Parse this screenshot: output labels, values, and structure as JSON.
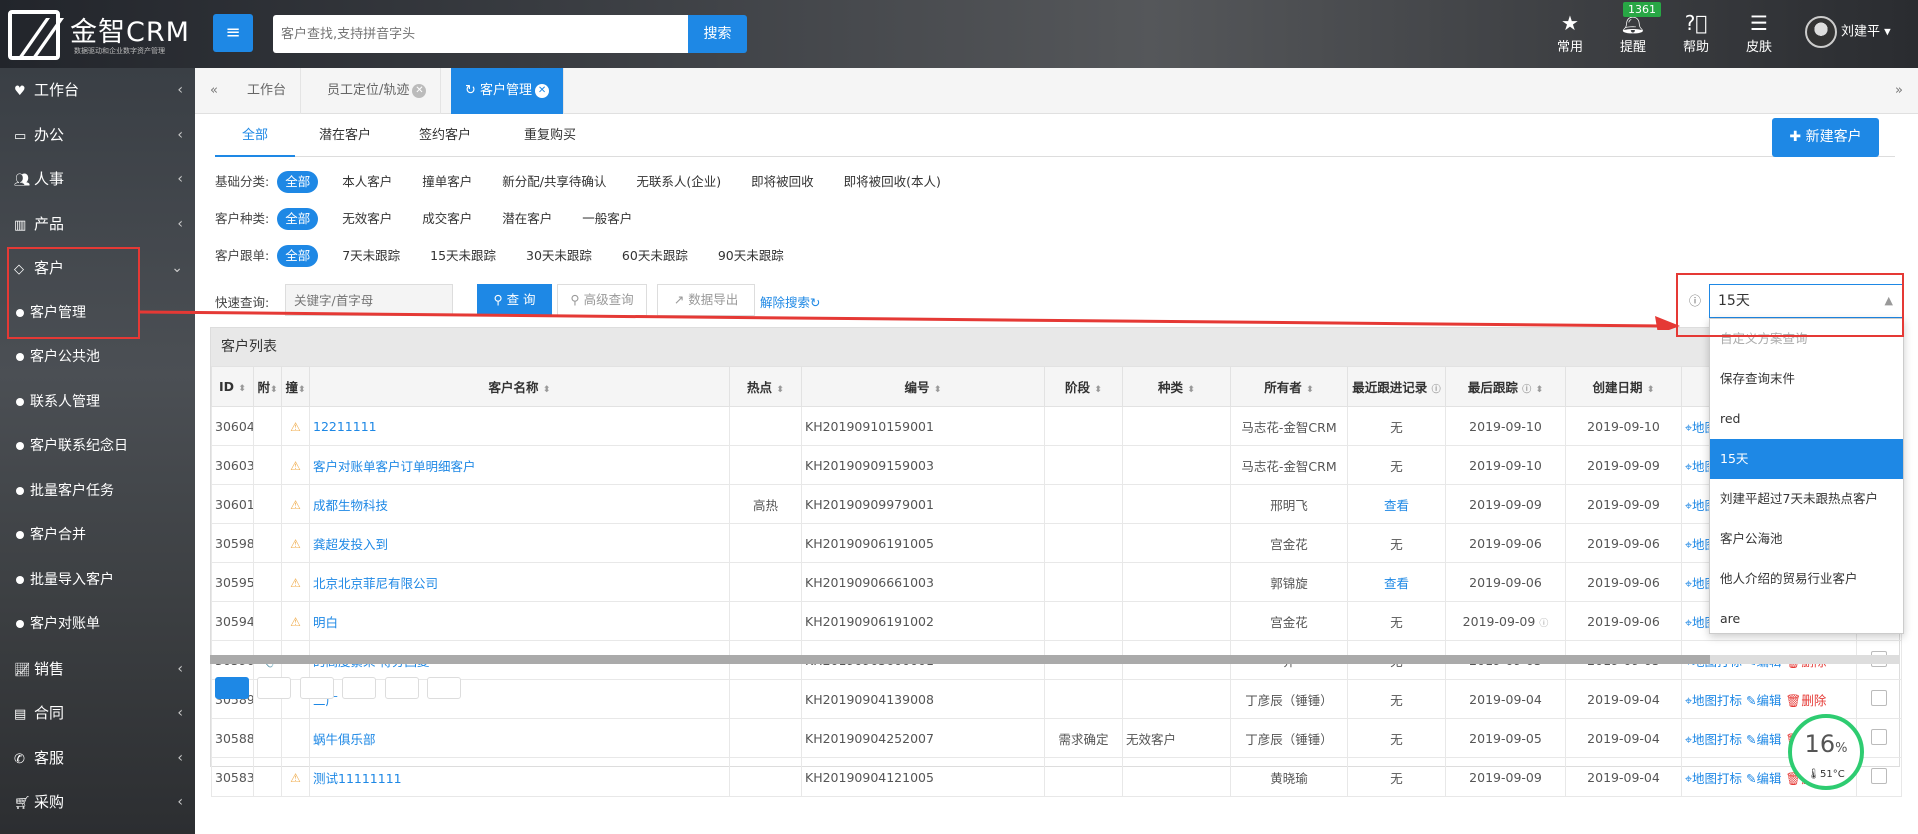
{
  "app": {
    "logo_title": "金智CRM",
    "logo_sub": "数据驱动和企业数字资产管理",
    "menu_icon": "hamburger-icon",
    "search_placeholder": "客户查找,支持拼音字头",
    "search_label": "搜索",
    "top_icons": [
      {
        "name": "star-icon",
        "label": "常用"
      },
      {
        "name": "bell-icon",
        "label": "提醒",
        "badge": "1361"
      },
      {
        "name": "help-icon",
        "label": "帮助"
      },
      {
        "name": "skin-icon",
        "label": "皮肤"
      }
    ],
    "user": "刘建平"
  },
  "sidebar": {
    "items": [
      {
        "label": "工作台",
        "icon": "heart-icon"
      },
      {
        "label": "办公",
        "icon": "laptop-icon"
      },
      {
        "label": "人事",
        "icon": "users-icon"
      },
      {
        "label": "产品",
        "icon": "barcode-icon"
      },
      {
        "label": "客户",
        "icon": "diamond-icon",
        "expanded": true
      }
    ],
    "sub_items": [
      "客户管理",
      "客户公共池",
      "联系人管理",
      "客户联系纪念日",
      "批量客户任务",
      "客户合并",
      "批量导入客户",
      "客户对账单"
    ],
    "items_after": [
      {
        "label": "销售",
        "icon": "chart-icon"
      },
      {
        "label": "合同",
        "icon": "contract-icon"
      },
      {
        "label": "客服",
        "icon": "phone-icon"
      },
      {
        "label": "采购",
        "icon": "cart-icon"
      }
    ]
  },
  "tabs": [
    {
      "label": "工作台",
      "closable": false
    },
    {
      "label": "员工定位/轨迹",
      "closable": true
    },
    {
      "label": "客户管理",
      "closable": true,
      "active": true
    }
  ],
  "subtabs": [
    "全部",
    "潜在客户",
    "签约客户",
    "重复购买"
  ],
  "new_button": "新建客户",
  "filters": [
    {
      "label": "基础分类:",
      "options": [
        "全部",
        "本人客户",
        "撞单客户",
        "新分配/共享待确认",
        "无联系人(企业)",
        "即将被回收",
        "即将被回收(本人)"
      ]
    },
    {
      "label": "客户种类:",
      "options": [
        "全部",
        "无效客户",
        "成交客户",
        "潜在客户",
        "一般客户"
      ]
    },
    {
      "label": "客户跟单:",
      "options": [
        "全部",
        "7天未跟踪",
        "15天未跟踪",
        "30天未跟踪",
        "60天未跟踪",
        "90天未跟踪"
      ]
    }
  ],
  "quick": {
    "label": "快速查询:",
    "placeholder": "关键字/首字母",
    "query_btn": "查 询",
    "advanced_btn": "高级查询",
    "export_btn": "数据导出",
    "clear_link": "解除搜索"
  },
  "scheme": {
    "value": "15天",
    "options": [
      "自定义方案查询",
      "保存查询末件",
      "red",
      "15天",
      "刘建平超过7天未跟热点客户",
      "客户公海池",
      "他人介绍的贸易行业客户",
      "are"
    ],
    "selected_index": 3
  },
  "list": {
    "title": "客户列表",
    "columns": [
      "ID",
      "附",
      "撞",
      "客户名称",
      "热点",
      "编号",
      "阶段",
      "种类",
      "所有者",
      "最近跟进记录",
      "最后跟踪",
      "创建日期",
      "",
      ""
    ],
    "rows": [
      {
        "id": "30604",
        "att": "",
        "warn": "⚠",
        "name": "12211111",
        "hot": "",
        "code": "KH20190910159001",
        "stage": "",
        "kind": "",
        "owner": "马志花-金智CRM",
        "recent": "无",
        "recent_link": false,
        "last": "2019-09-10",
        "last_info": false,
        "created": "2019-09-10"
      },
      {
        "id": "30603",
        "att": "",
        "warn": "⚠",
        "name": "客户对账单客户订单明细客户",
        "hot": "",
        "code": "KH20190909159003",
        "stage": "",
        "kind": "",
        "owner": "马志花-金智CRM",
        "recent": "无",
        "recent_link": false,
        "last": "2019-09-10",
        "last_info": false,
        "created": "2019-09-09"
      },
      {
        "id": "30601",
        "att": "",
        "warn": "⚠",
        "name": "成都生物科技",
        "hot": "高热",
        "code": "KH20190909979001",
        "stage": "",
        "kind": "",
        "owner": "邢明飞",
        "recent": "查看",
        "recent_link": true,
        "last": "2019-09-09",
        "last_info": false,
        "created": "2019-09-09"
      },
      {
        "id": "30598",
        "att": "",
        "warn": "⚠",
        "name": "龚超发投入到",
        "hot": "",
        "code": "KH20190906191005",
        "stage": "",
        "kind": "",
        "owner": "宫金花",
        "recent": "无",
        "recent_link": false,
        "last": "2019-09-06",
        "last_info": false,
        "created": "2019-09-06"
      },
      {
        "id": "30595",
        "att": "",
        "warn": "⚠",
        "name": "北京北京菲尼有限公司",
        "hot": "",
        "code": "KH20190906661003",
        "stage": "",
        "kind": "",
        "owner": "郭锦旋",
        "recent": "查看",
        "recent_link": true,
        "last": "2019-09-06",
        "last_info": false,
        "created": "2019-09-06"
      },
      {
        "id": "30594",
        "att": "",
        "warn": "⚠",
        "name": "明白",
        "hot": "",
        "code": "KH20190906191002",
        "stage": "",
        "kind": "",
        "owner": "宫金花",
        "recent": "无",
        "recent_link": false,
        "last": "2019-09-09",
        "last_info": true,
        "created": "2019-09-06"
      },
      {
        "id": "30590",
        "att": "📎",
        "warn": "",
        "name": "的高度繁荣 得分回复",
        "hot": "",
        "code": "KH20190905600001",
        "stage": "",
        "kind": "",
        "owner": "乔",
        "recent": "无",
        "recent_link": false,
        "last": "2019-09-05",
        "last_info": false,
        "created": "2019-09-05"
      },
      {
        "id": "30589",
        "att": "",
        "warn": "",
        "name": "二广",
        "hot": "",
        "code": "KH20190904139008",
        "stage": "",
        "kind": "",
        "owner": "丁彦辰（锤锤）",
        "recent": "无",
        "recent_link": false,
        "last": "2019-09-04",
        "last_info": false,
        "created": "2019-09-04"
      },
      {
        "id": "30588",
        "att": "",
        "warn": "",
        "name": "蜗牛俱乐部",
        "hot": "",
        "code": "KH20190904252007",
        "stage": "需求确定",
        "kind": "无效客户",
        "owner": "丁彦辰（锤锤）",
        "recent": "无",
        "recent_link": false,
        "last": "2019-09-05",
        "last_info": false,
        "created": "2019-09-04"
      },
      {
        "id": "30583",
        "att": "",
        "warn": "⚠",
        "name": "测试11111111",
        "hot": "",
        "code": "KH20190904121005",
        "stage": "",
        "kind": "",
        "owner": "黄晓瑜",
        "recent": "无",
        "recent_link": false,
        "last": "2019-09-09",
        "last_info": false,
        "created": "2019-09-04"
      }
    ],
    "actions": {
      "map": "地图打标",
      "edit": "编辑",
      "del": "删除"
    }
  },
  "gauge": {
    "percent": "16",
    "unit": "%",
    "temp": "51°C"
  },
  "colors": {
    "primary": "#1e88e5",
    "annotation": "#e53935",
    "warn": "#f0ad4e"
  }
}
